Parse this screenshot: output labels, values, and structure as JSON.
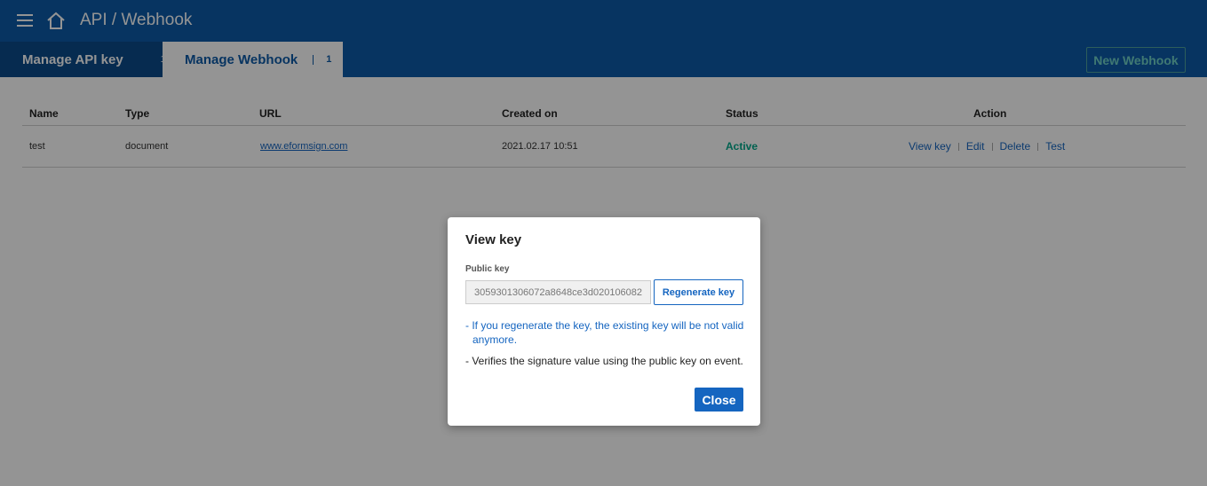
{
  "header": {
    "title": "API / Webhook",
    "menu_icon": "hamburger-menu-icon",
    "home_icon": "home-icon"
  },
  "tabs": [
    {
      "label": "Manage API key",
      "count": "1",
      "active": false
    },
    {
      "label": "Manage Webhook",
      "count": "1",
      "active": true
    }
  ],
  "toolbar": {
    "new_webhook_label": "New Webhook"
  },
  "table": {
    "columns": [
      "Name",
      "Type",
      "URL",
      "Created on",
      "Status",
      "Action"
    ],
    "rows": [
      {
        "name": "test",
        "type": "document",
        "url": "www.eformsign.com",
        "created_on": "2021.02.17 10:51",
        "status": "Active",
        "actions": [
          "View key",
          "Edit",
          "Delete",
          "Test"
        ]
      }
    ]
  },
  "modal": {
    "title": "View key",
    "public_key_label": "Public key",
    "public_key_value": "3059301306072a8648ce3d020106082",
    "regenerate_label": "Regenerate key",
    "warning_line1": "- If you regenerate the key, the existing key will be not valid",
    "warning_line2": "anymore.",
    "info_text": "- Verifies the signature value using the public key on event.",
    "close_label": "Close"
  },
  "colors": {
    "header_bg": "#0d5aa7",
    "primary": "#1565c0",
    "status_active": "#00a88a",
    "overlay": "rgba(0,0,0,0.42)"
  }
}
